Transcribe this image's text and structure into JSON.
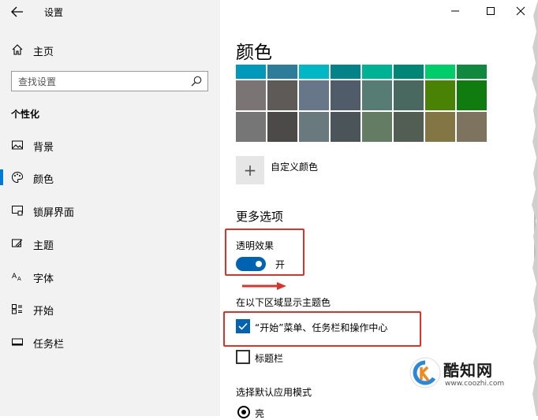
{
  "window": {
    "title": "设置",
    "controls": [
      "minimize-icon",
      "maximize-icon",
      "close-icon"
    ]
  },
  "nav": {
    "home": "主页",
    "search_placeholder": "查找设置",
    "section": "个性化",
    "items": [
      {
        "label": "背景",
        "icon": "picture-icon",
        "active": false
      },
      {
        "label": "颜色",
        "icon": "palette-icon",
        "active": true
      },
      {
        "label": "锁屏界面",
        "icon": "lock-screen-icon",
        "active": false
      },
      {
        "label": "主题",
        "icon": "theme-icon",
        "active": false
      },
      {
        "label": "字体",
        "icon": "font-icon",
        "active": false
      },
      {
        "label": "开始",
        "icon": "start-icon",
        "active": false
      },
      {
        "label": "任务栏",
        "icon": "taskbar-icon",
        "active": false
      }
    ]
  },
  "main": {
    "heading": "颜色",
    "swatch_rows": [
      [
        "#0099bc",
        "#2d7d9a",
        "#00b7c3",
        "#038387",
        "#00b294",
        "#018574",
        "#00cc6a",
        "#10893e"
      ],
      [
        "#7a7574",
        "#5d5a58",
        "#68768a",
        "#515c6b",
        "#567c73",
        "#486860",
        "#498205",
        "#107c10"
      ],
      [
        "#767676",
        "#4c4a48",
        "#69797e",
        "#4a5459",
        "#647c64",
        "#525e54",
        "#847545",
        "#7e735f"
      ]
    ],
    "custom_color_label": "自定义颜色",
    "more_options": "更多选项",
    "transparency_label": "透明效果",
    "transparency_state": "开",
    "show_accent_label": "在以下区域显示主题色",
    "checkbox_start": "“开始”菜单、任务栏和操作中心",
    "checkbox_start_checked": true,
    "checkbox_titlebar": "标题栏",
    "checkbox_titlebar_checked": false,
    "app_mode_label": "选择默认应用模式",
    "app_mode_option": "亮"
  },
  "watermark": {
    "name": "酷知网",
    "url": "www.coozhi.com"
  },
  "colors": {
    "accent": "#0078d7",
    "highlight_box": "#d9342b"
  }
}
